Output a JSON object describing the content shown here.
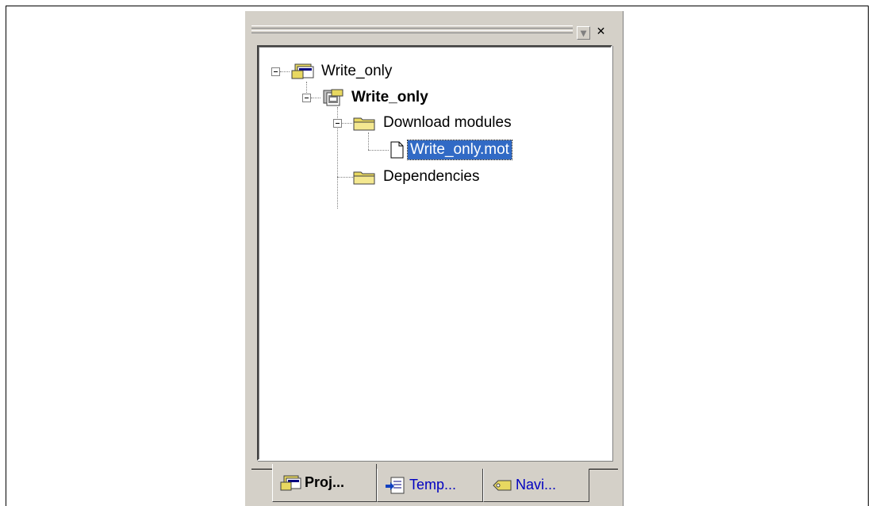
{
  "window": {
    "menu_glyph": "▾",
    "close_glyph": "✕"
  },
  "tree": {
    "items": [
      {
        "label": "Write_only",
        "icon": "workspace-icon",
        "expanded": true
      },
      {
        "label": "Write_only",
        "icon": "project-icon",
        "expanded": true,
        "bold": true
      },
      {
        "label": "Download modules",
        "icon": "folder-icon",
        "expanded": true
      },
      {
        "label": "Write_only.mot",
        "icon": "file-icon",
        "selected": true
      },
      {
        "label": "Dependencies",
        "icon": "folder-icon"
      }
    ]
  },
  "tabs": [
    {
      "label": "Proj...",
      "icon": "projects-tab-icon",
      "active": true
    },
    {
      "label": "Temp...",
      "icon": "templates-tab-icon"
    },
    {
      "label": "Navi...",
      "icon": "navigation-tab-icon"
    }
  ],
  "colors": {
    "selection": "#316ac5",
    "panel": "#d4d0c8",
    "folder": "#e8d860",
    "tab_text": "#0000c0"
  }
}
